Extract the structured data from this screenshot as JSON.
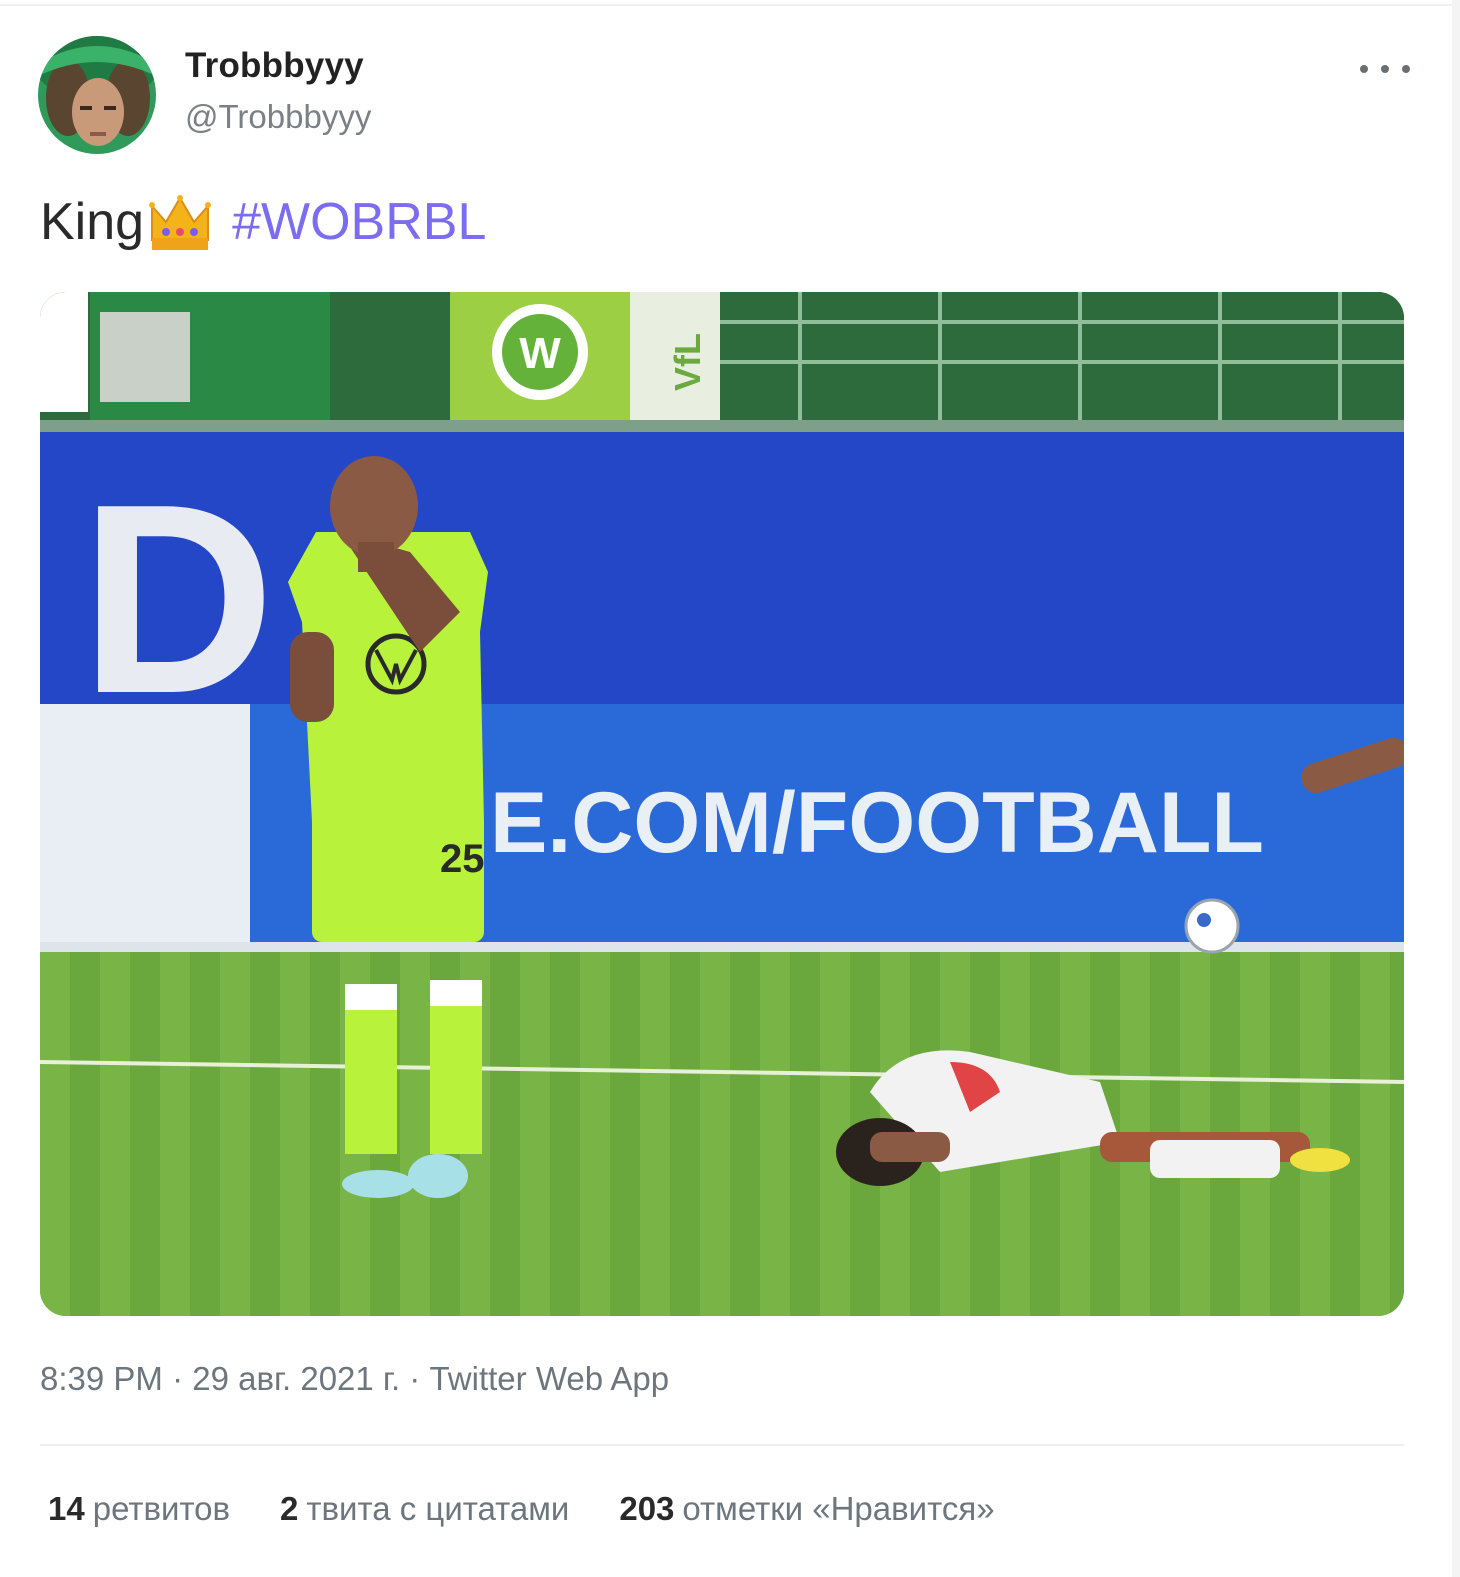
{
  "author": {
    "display_name": "Trobbbyyy",
    "handle": "@Trobbbyyy"
  },
  "tweet": {
    "text": "King",
    "emoji": "crown-emoji",
    "hashtag": "#WOBRBL"
  },
  "media": {
    "board_text": "E.COM/FOOTBALL",
    "board_letter": "D",
    "flag_text": "VfL",
    "jersey_number": "25"
  },
  "meta": {
    "time": "8:39 PM",
    "separator1": "·",
    "date": "29 авг. 2021 г.",
    "separator2": "·",
    "source": "Twitter Web App"
  },
  "stats": {
    "retweets_count": "14",
    "retweets_label": "ретвитов",
    "quotes_count": "2",
    "quotes_label": "твита с цитатами",
    "likes_count": "203",
    "likes_label": "отметки «Нравится»"
  },
  "colors": {
    "hashtag": "#7b6cf0",
    "meta_text": "#6e767d",
    "jersey_green": "#b8f23a",
    "board_blue": "#2447c8"
  }
}
